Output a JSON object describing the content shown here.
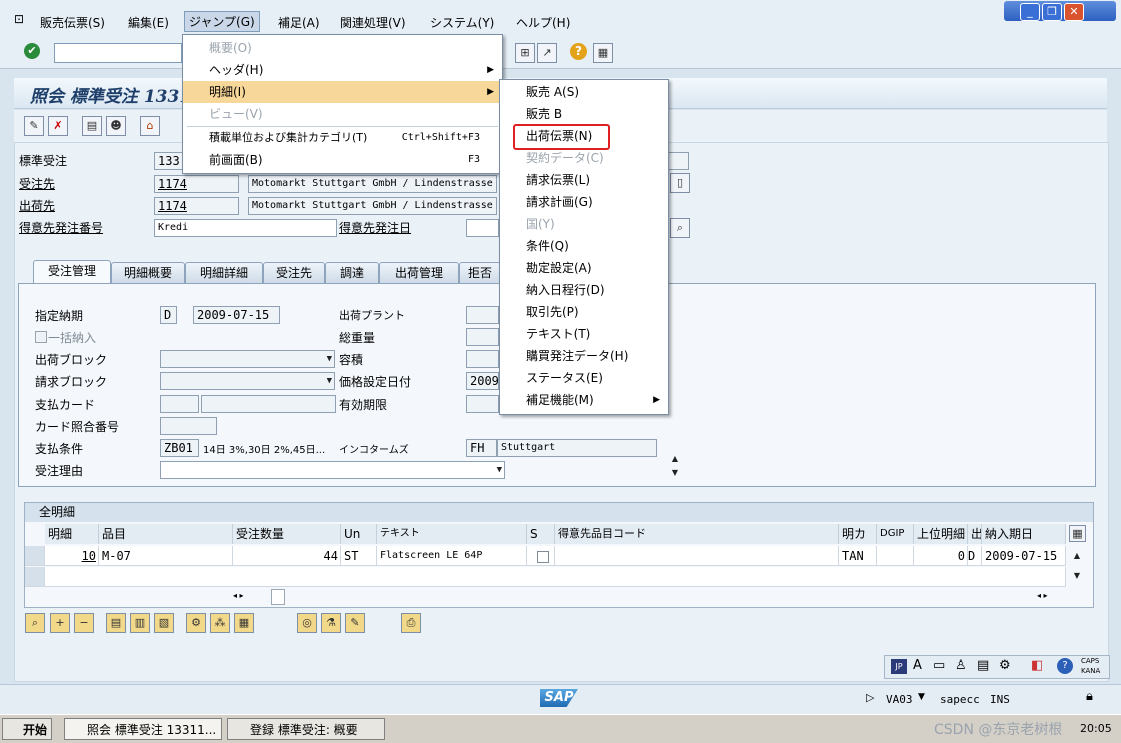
{
  "menubar": {
    "items": [
      "販売伝票(S)",
      "編集(E)",
      "ジャンプ(G)",
      "補足(A)",
      "関連処理(V)",
      "システム(Y)",
      "ヘルプ(H)"
    ]
  },
  "window_controls": {
    "minimize": "_",
    "restore": "❐",
    "close": "✕"
  },
  "title": "照会 標準受注 13311...",
  "jump_menu": {
    "items": [
      {
        "label": "概要(O)",
        "disabled": true
      },
      {
        "label": "ヘッダ(H)",
        "disabled": false,
        "submenu": true
      },
      {
        "label": "明細(I)",
        "disabled": false,
        "submenu": true,
        "highlighted": true
      },
      {
        "label": "ビュー(V)",
        "disabled": true
      },
      {
        "label": "積載単位および集計カテゴリ(T)",
        "shortcut": "Ctrl+Shift+F3"
      },
      {
        "label": "前画面(B)",
        "shortcut": "F3"
      }
    ]
  },
  "item_submenu": {
    "items": [
      {
        "label": "販売 A(S)"
      },
      {
        "label": "販売 B"
      },
      {
        "label": "出荷伝票(N)",
        "boxed": true
      },
      {
        "label": "契約データ(C)",
        "disabled": true
      },
      {
        "label": "請求伝票(L)"
      },
      {
        "label": "請求計画(G)"
      },
      {
        "label": "国(Y)",
        "disabled": true
      },
      {
        "label": "条件(Q)"
      },
      {
        "label": "勘定設定(A)"
      },
      {
        "label": "納入日程行(D)"
      },
      {
        "label": "取引先(P)"
      },
      {
        "label": "テキスト(T)"
      },
      {
        "label": "購買発注データ(H)"
      },
      {
        "label": "ステータス(E)"
      },
      {
        "label": "補足機能(M)",
        "submenu": true
      }
    ]
  },
  "header": {
    "order_type_label": "標準受注",
    "order_number_value": "133",
    "sold_to_label": "受注先",
    "sold_to_value": "1174",
    "sold_to_name": "Motomarkt Stuttgart GmbH / Lindenstrasse",
    "ship_to_label": "出荷先",
    "ship_to_value": "1174",
    "ship_to_name": "Motomarkt Stuttgart GmbH / Lindenstrasse",
    "po_label": "得意先発注番号",
    "po_value": "Kredi",
    "po_date_label": "得意先発注日"
  },
  "tabs": [
    "受注管理",
    "明細概要",
    "明細詳細",
    "受注先",
    "調達",
    "出荷管理",
    "拒否"
  ],
  "form": {
    "req_delivery_label": "指定納期",
    "req_delivery_type": "D",
    "req_delivery_date": "2009-07-15",
    "complete_delivery_label": "一括納入",
    "delivery_block_label": "出荷ブロック",
    "billing_block_label": "請求ブロック",
    "payment_card_label": "支払カード",
    "card_verification_label": "カード照合番号",
    "payment_terms_label": "支払条件",
    "payment_terms_code": "ZB01",
    "payment_terms_text": "14日 3%,30日 2%,45日...",
    "order_reason_label": "受注理由",
    "plant_label": "出荷プラント",
    "total_weight_label": "総重量",
    "volume_label": "容積",
    "pricing_date_label": "価格設定日付",
    "pricing_date_value": "2009",
    "valid_to_label": "有効期限",
    "incoterms_label": "インコタームズ",
    "incoterms_code": "FH",
    "incoterms_place": "Stuttgart"
  },
  "table": {
    "title": "全明細",
    "columns": [
      "明細",
      "品目",
      "受注数量",
      "Un",
      "テキスト",
      "S",
      "得意先品目コード",
      "明カ",
      "DGIP",
      "上位明細",
      "出",
      "納入期日"
    ],
    "rows": [
      {
        "item": "10",
        "material": "M-07",
        "qty": "44",
        "unit": "ST",
        "text": "Flatscreen LE 64P",
        "cust_material": "",
        "category": "TAN",
        "higher": "0",
        "ship": "D",
        "date": "2009-07-15"
      }
    ]
  },
  "status": {
    "transaction": "VA03",
    "system": "sapecc",
    "mode": "INS",
    "caps": "CAPS",
    "kana": "KANA",
    "jp": "JP"
  },
  "taskbar": {
    "start": "开始",
    "tasks": [
      "照会 標準受注 13311...",
      "登録 標準受注: 概要"
    ],
    "clock": "20:05",
    "watermark": "CSDN @东京老树根"
  },
  "sap_logo": "SAP"
}
